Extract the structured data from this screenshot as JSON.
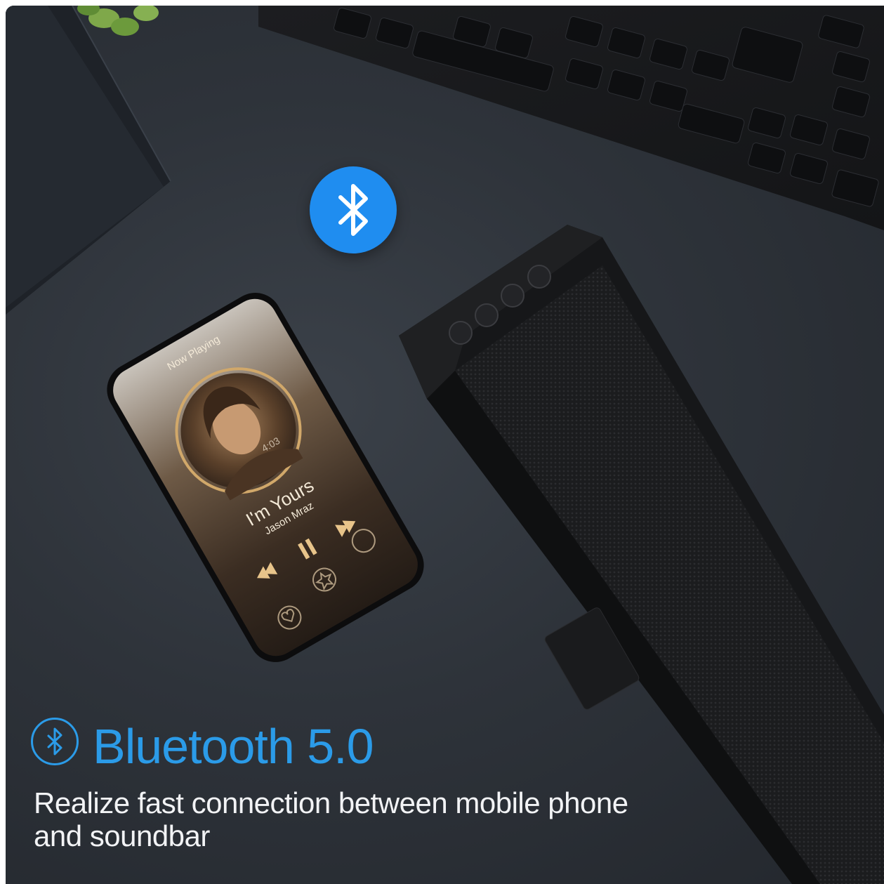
{
  "headline": "Bluetooth 5.0",
  "subheadline": "Realize fast connection between mobile phone and soundbar",
  "phone_screen": {
    "header": "Now Playing",
    "song_title": "I'm Yours",
    "artist": "Jason Mraz",
    "time": "4:03"
  },
  "icons": [
    "bluetooth-badge-icon",
    "bluetooth-ring-icon",
    "play-pause-icon",
    "previous-track-icon",
    "next-track-icon",
    "heart-icon",
    "star-icon",
    "share-icon"
  ],
  "colors": {
    "accent": "#2b9be8",
    "badge": "#1f8df0",
    "text": "#f2f3f5",
    "background": "#2e333a"
  }
}
